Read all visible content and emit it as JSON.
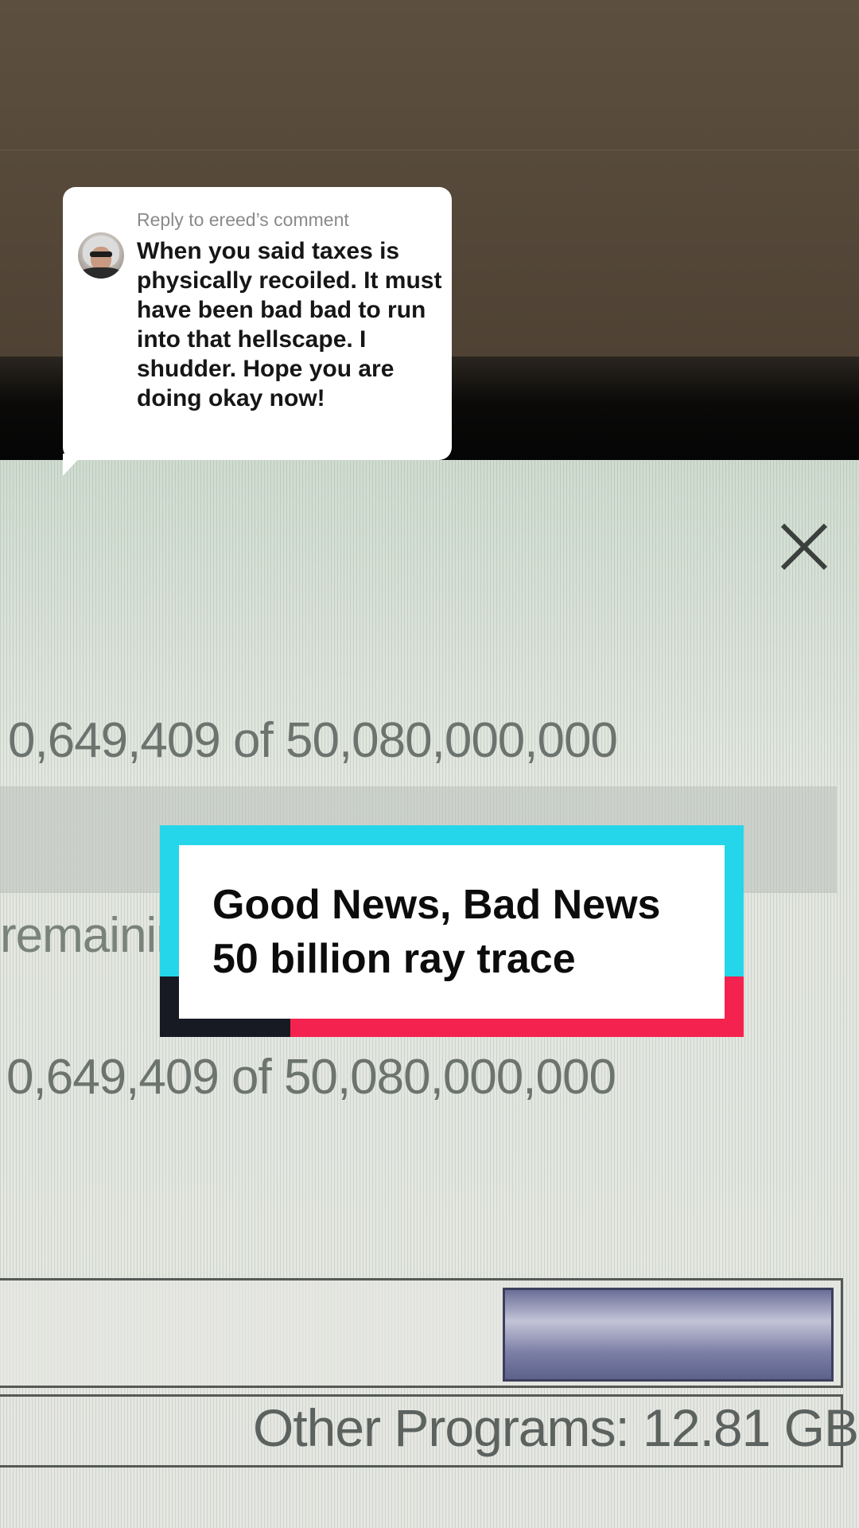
{
  "reply": {
    "label": "Reply to ereed’s comment",
    "text": "When you said taxes is physically recoiled. It must have been bad bad to run into that hellscape. I shudder. Hope you are doing okay now!"
  },
  "screen": {
    "count_line_1": "0,649,409 of 50,080,000,000",
    "remaining_text": "remainin",
    "count_line_2": "0,649,409 of 50,080,000,000",
    "memory_bar_fill_fraction": 0.39,
    "other_programs": "Other Programs: 12.81 GB"
  },
  "title_card": {
    "line1": "Good News, Bad News",
    "line2": "50 billion ray trace"
  },
  "colors": {
    "card_cyan": "#25d6ea",
    "card_red": "#f4224e",
    "card_dark": "#171a23"
  }
}
